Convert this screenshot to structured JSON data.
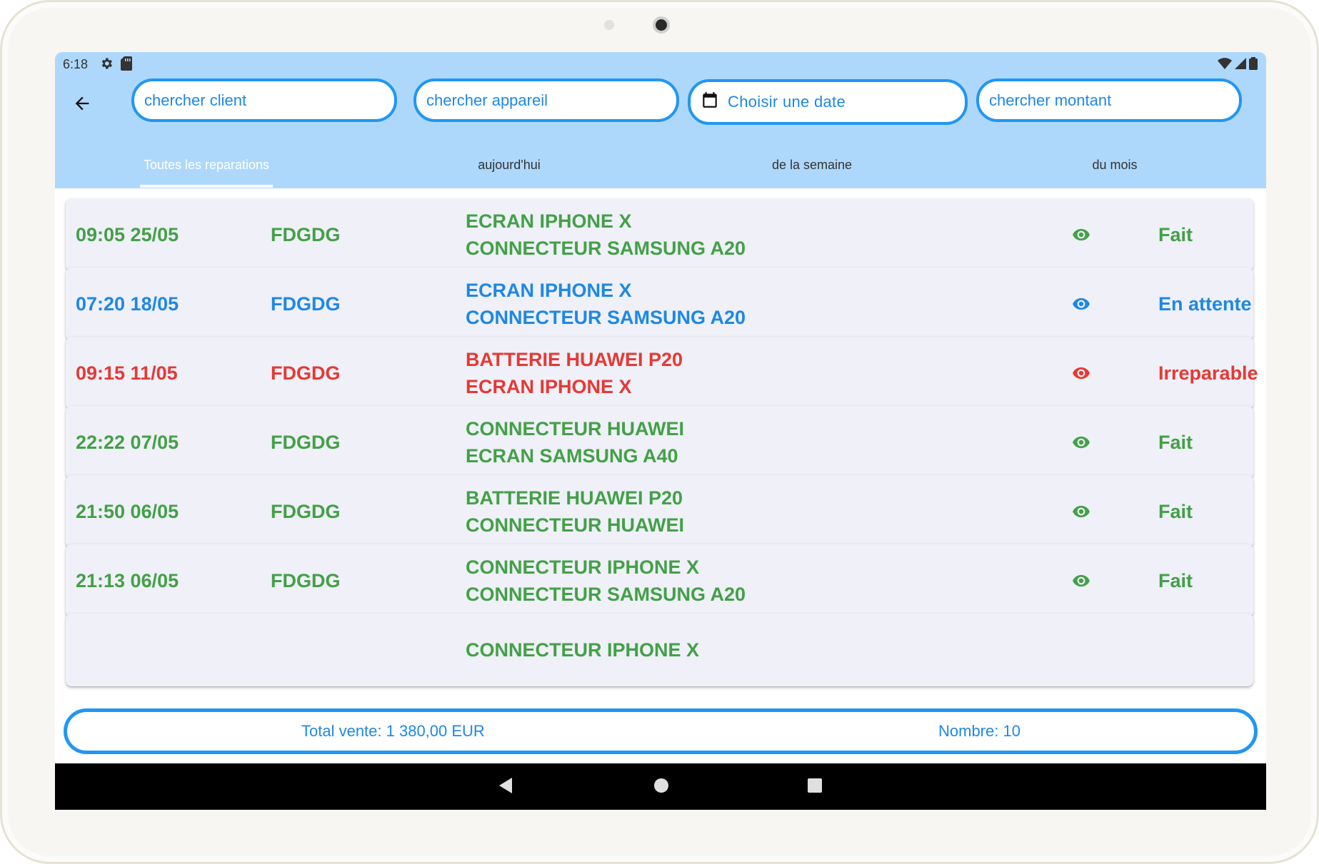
{
  "status_bar": {
    "time": "6:18",
    "left_icons": [
      "gear-icon",
      "sd-card-icon"
    ],
    "right_icons": [
      "wifi-icon",
      "signal-icon",
      "battery-icon"
    ]
  },
  "header": {
    "back_icon": "arrow-left-icon",
    "search_client_placeholder": "chercher client",
    "search_device_placeholder": "chercher appareil",
    "date_label": "Choisir une date",
    "date_icon": "calendar-icon",
    "search_amount_placeholder": "chercher montant"
  },
  "tabs": [
    {
      "label": "Toutes les reparations",
      "active": true
    },
    {
      "label": "aujourd'hui",
      "active": false
    },
    {
      "label": "de la semaine",
      "active": false
    },
    {
      "label": "du mois",
      "active": false
    }
  ],
  "repairs": [
    {
      "time": "09:05 25/05",
      "client": "FDGDG",
      "devices": [
        "ECRAN IPHONE X",
        "CONNECTEUR SAMSUNG A20"
      ],
      "status": "Fait",
      "color": "green"
    },
    {
      "time": "07:20 18/05",
      "client": "FDGDG",
      "devices": [
        "ECRAN IPHONE X",
        "CONNECTEUR SAMSUNG A20"
      ],
      "status": "En attente",
      "color": "blue"
    },
    {
      "time": "09:15 11/05",
      "client": "FDGDG",
      "devices": [
        "BATTERIE HUAWEI P20",
        "ECRAN IPHONE X"
      ],
      "status": "Irreparable",
      "color": "red"
    },
    {
      "time": "22:22 07/05",
      "client": "FDGDG",
      "devices": [
        "CONNECTEUR HUAWEI",
        "ECRAN SAMSUNG A40"
      ],
      "status": "Fait",
      "color": "green"
    },
    {
      "time": "21:50 06/05",
      "client": "FDGDG",
      "devices": [
        "BATTERIE HUAWEI P20",
        "CONNECTEUR HUAWEI"
      ],
      "status": "Fait",
      "color": "green"
    },
    {
      "time": "21:13 06/05",
      "client": "FDGDG",
      "devices": [
        "CONNECTEUR IPHONE X",
        "CONNECTEUR SAMSUNG A20"
      ],
      "status": "Fait",
      "color": "green"
    },
    {
      "time": "",
      "client": "",
      "devices": [
        "CONNECTEUR IPHONE X",
        ""
      ],
      "status": "",
      "color": "green"
    }
  ],
  "colors": {
    "green": "#43a047",
    "blue": "#1e88e5",
    "red": "#e53935",
    "appbar": "#aed8fb",
    "accent": "#2196f3"
  },
  "footer": {
    "total": "Total vente: 1 380,00 EUR",
    "count": "Nombre: 10"
  },
  "nav_bar": {
    "icons": [
      "nav-back-icon",
      "nav-home-icon",
      "nav-recents-icon"
    ]
  }
}
